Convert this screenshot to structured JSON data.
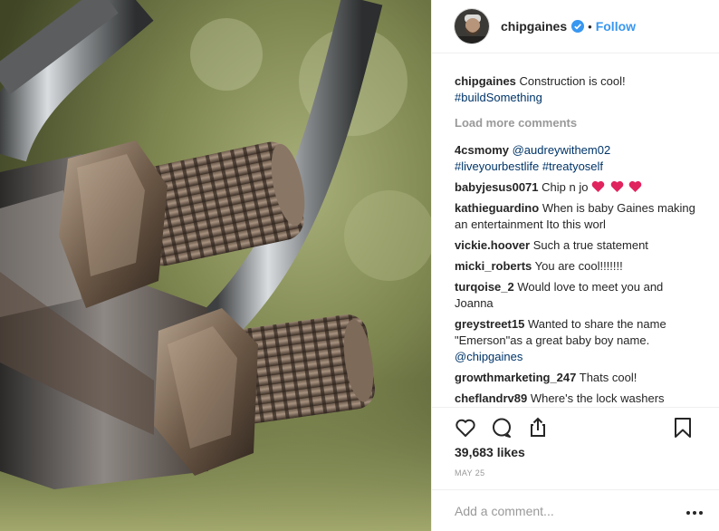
{
  "header": {
    "username": "chipgaines",
    "separator": "•",
    "follow_label": "Follow"
  },
  "caption": {
    "username": "chipgaines",
    "text": "Construction is cool!",
    "hashtag": "#buildSomething"
  },
  "load_more_label": "Load more comments",
  "comments": [
    {
      "user": "4csmomy",
      "mention": "@audreywithem02",
      "hashtags": "#liveyourbestlife #treatyoself"
    },
    {
      "user": "babyjesus0071",
      "text": "Chip n jo"
    },
    {
      "user": "kathieguardino",
      "text": "When is baby Gaines making an entertainment Ito this worl"
    },
    {
      "user": "vickie.hoover",
      "text": "Such a true statement"
    },
    {
      "user": "micki_roberts",
      "text": "You are cool!!!!!!!"
    },
    {
      "user": "turqoise_2",
      "text": "Would love to meet you and Joanna"
    },
    {
      "user": "greystreet15",
      "text": "Wanted to share the name \"Emerson\"as a great baby boy name.",
      "mention": "@chipgaines"
    },
    {
      "user": "growthmarketing_247",
      "text": "Thats cool!"
    },
    {
      "user": "cheflandrv89",
      "text": "Where's the lock washers"
    }
  ],
  "likes": "39,683 likes",
  "date": "MAY 25",
  "add_comment": {
    "placeholder": "Add a comment..."
  },
  "icons": {
    "like": "heart-outline-icon",
    "comment": "comment-bubble-icon",
    "share": "share-icon",
    "save": "bookmark-icon",
    "verified": "verified-badge-icon",
    "more": "more-options-icon"
  },
  "colors": {
    "link": "#3897f0",
    "hashtag": "#003569",
    "muted": "#999999",
    "heart_emoji": "#e0245e"
  }
}
